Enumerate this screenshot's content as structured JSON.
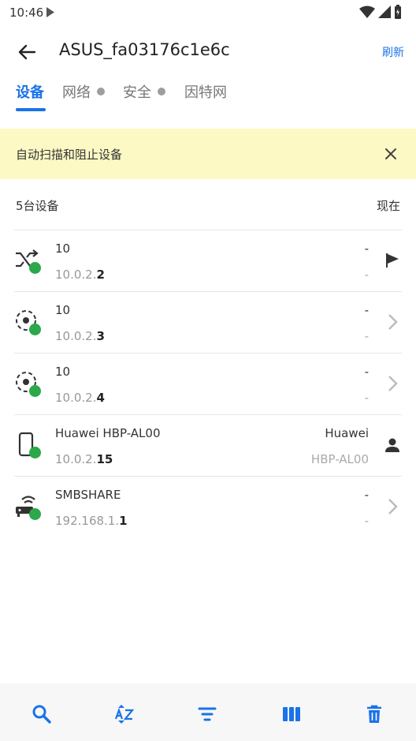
{
  "status_bar": {
    "time": "10:46"
  },
  "app_bar": {
    "title": "ASUS_fa03176c1e6c",
    "refresh_label": "刷新"
  },
  "tabs": [
    {
      "label": "设备",
      "active": true,
      "has_dot": false
    },
    {
      "label": "网络",
      "active": false,
      "has_dot": true
    },
    {
      "label": "安全",
      "active": false,
      "has_dot": true
    },
    {
      "label": "因特网",
      "active": false,
      "has_dot": false
    }
  ],
  "banner": {
    "text": "自动扫描和阻止设备"
  },
  "summary": {
    "count": "5台设备",
    "when": "现在"
  },
  "devices": [
    {
      "name": "10",
      "ip_prefix": "10.0.2.",
      "ip_suffix": "2",
      "vendor": "-",
      "model": "-",
      "icon": "shuffle-icon",
      "action": "flag-icon"
    },
    {
      "name": "10",
      "ip_prefix": "10.0.2.",
      "ip_suffix": "3",
      "vendor": "-",
      "model": "-",
      "icon": "unknown-device-icon",
      "action": "chevron-right-icon"
    },
    {
      "name": "10",
      "ip_prefix": "10.0.2.",
      "ip_suffix": "4",
      "vendor": "-",
      "model": "-",
      "icon": "unknown-device-icon",
      "action": "chevron-right-icon"
    },
    {
      "name": "Huawei HBP-AL00",
      "ip_prefix": "10.0.2.",
      "ip_suffix": "15",
      "vendor": "Huawei",
      "model": "HBP-AL00",
      "icon": "phone-icon",
      "action": "person-icon"
    },
    {
      "name": "SMBSHARE",
      "ip_prefix": "192.168.1.",
      "ip_suffix": "1",
      "vendor": "-",
      "model": "-",
      "icon": "router-icon",
      "action": "chevron-right-icon"
    }
  ],
  "bottom_bar": [
    "search-icon",
    "sort-az-icon",
    "filter-icon",
    "columns-icon",
    "delete-icon"
  ],
  "colors": {
    "accent": "#1a73e8",
    "online": "#2ba84a",
    "banner_bg": "#fcf9c4"
  }
}
